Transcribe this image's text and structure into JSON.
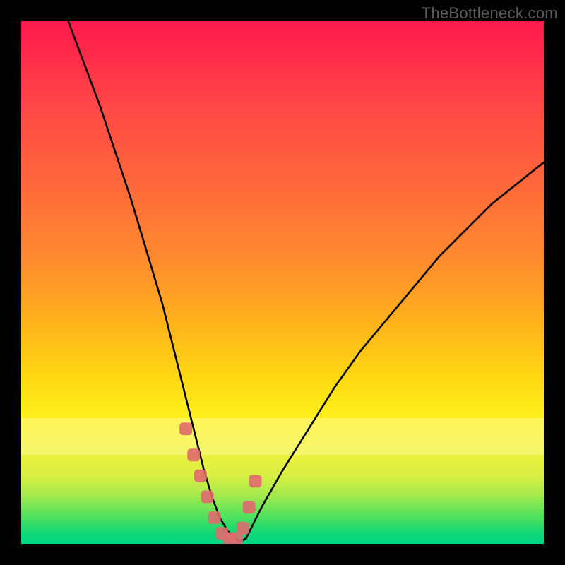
{
  "watermark": "TheBottleneck.com",
  "chart_data": {
    "type": "line",
    "title": "",
    "xlabel": "",
    "ylabel": "",
    "xlim": [
      0,
      100
    ],
    "ylim": [
      0,
      100
    ],
    "grid": false,
    "legend": false,
    "series": [
      {
        "name": "bottleneck-curve",
        "color": "#000000",
        "x": [
          9,
          12,
          15,
          18,
          21,
          24,
          27,
          30,
          32,
          33.5,
          35,
          36.5,
          38,
          39.5,
          41,
          42,
          43,
          44,
          46,
          50,
          55,
          60,
          65,
          70,
          75,
          80,
          85,
          90,
          95,
          100
        ],
        "y": [
          100,
          92,
          84,
          75,
          66,
          56,
          46,
          34,
          26,
          20,
          14,
          9,
          5,
          2.5,
          1,
          0.5,
          1,
          3,
          7,
          14,
          22,
          30,
          37,
          43,
          49,
          55,
          60,
          65,
          69,
          73
        ]
      },
      {
        "name": "marker-cluster",
        "color": "#e06a6e",
        "type": "scatter",
        "x": [
          31.5,
          33.0,
          34.3,
          35.6,
          37.0,
          38.4,
          39.8,
          41.2,
          42.4,
          43.6,
          44.8
        ],
        "y": [
          22.0,
          17.0,
          13.0,
          9.0,
          5.0,
          2.0,
          1.0,
          1.0,
          3.0,
          7.0,
          12.0
        ]
      }
    ]
  }
}
